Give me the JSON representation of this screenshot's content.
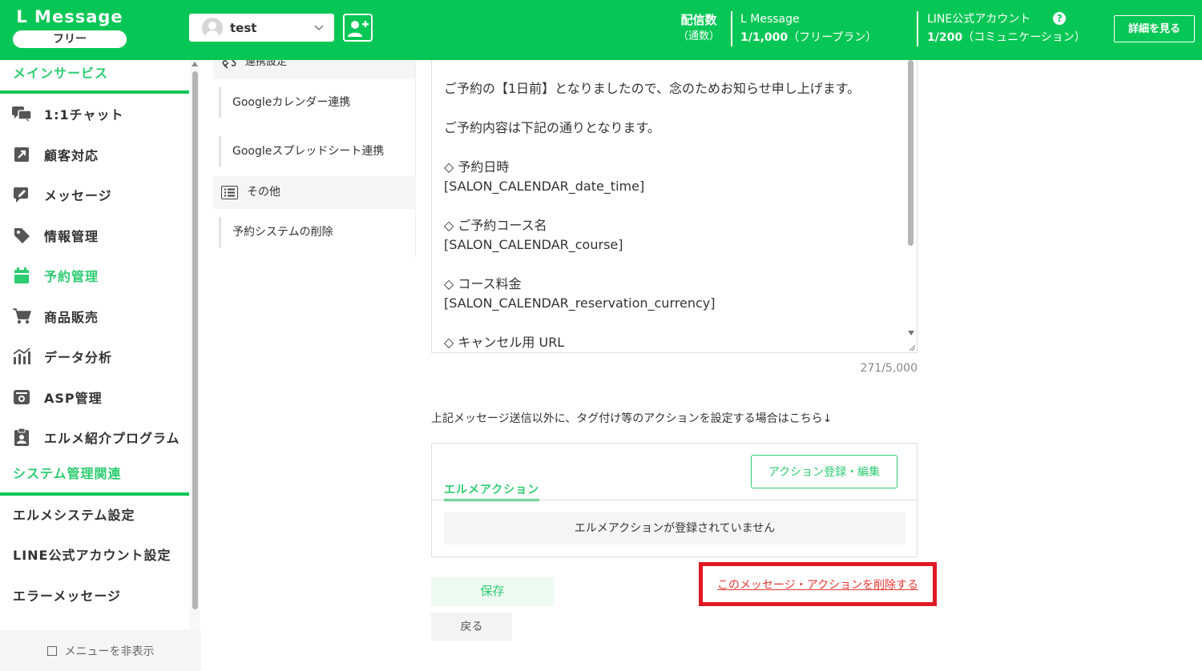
{
  "header": {
    "logo_title": "L Message",
    "logo_plan": "フリー",
    "account_name": "test",
    "stat_delivery_label": "配信数",
    "stat_delivery_sub": "（通数）",
    "lmessage_label": "L Message",
    "lmessage_count": "1/1,000",
    "lmessage_plan": "（フリープラン）",
    "line_label": "LINE公式アカウント",
    "line_count": "1/200",
    "line_plan": "（コミュニケーション）",
    "help_glyph": "?",
    "detail_button": "詳細を見る",
    "colors": {
      "brand": "#06c755",
      "accent": "#2ecc71",
      "alert": "#e01a22"
    },
    "icons": {
      "avatar": "user-avatar-icon",
      "dropdown": "chevron-down-icon",
      "add_user": "add-user-icon"
    }
  },
  "sidebar": {
    "section_main": "メインサービス",
    "items": [
      {
        "label": "1:1チャット",
        "icon": "chat-icon"
      },
      {
        "label": "顧客対応",
        "icon": "external-link-icon"
      },
      {
        "label": "メッセージ",
        "icon": "message-edit-icon"
      },
      {
        "label": "情報管理",
        "icon": "tag-icon"
      },
      {
        "label": "予約管理",
        "icon": "calendar-icon",
        "active": true
      },
      {
        "label": "商品販売",
        "icon": "cart-icon"
      },
      {
        "label": "データ分析",
        "icon": "chart-icon"
      },
      {
        "label": "ASP管理",
        "icon": "asp-icon"
      },
      {
        "label": "エルメ紹介プログラム",
        "icon": "clipboard-user-icon"
      }
    ],
    "section_system": "システム管理関連",
    "system_items": [
      "エルメシステム設定",
      "LINE公式アカウント設定",
      "エラーメッセージ"
    ],
    "footer": "メニューを非表示"
  },
  "submenu": {
    "header_partial": "連携設定",
    "items": [
      "Googleカレンダー連携",
      "Googleスプレッドシート連携"
    ],
    "other": "その他",
    "delete_system": "予約システムの削除"
  },
  "message": {
    "lines": "ご予約の【1日前】となりましたので、念のためお知らせ申し上げます。\n\nご予約内容は下記の通りとなります。\n\n◇ 予約日時\n[SALON_CALENDAR_date_time]\n\n◇ ご予約コース名\n[SALON_CALENDAR_course]\n\n◇ コース料金\n[SALON_CALENDAR_reservation_currency]\n\n◇ キャンセル用 URL",
    "counter": "271/5,000",
    "note": "上記メッセージ送信以外に、タグ付け等のアクションを設定する場合はこちら↓"
  },
  "action": {
    "tab": "エルメアクション",
    "register_button": "アクション登録・編集",
    "empty": "エルメアクションが登録されていません"
  },
  "buttons": {
    "save": "保存",
    "back": "戻る",
    "delete": "このメッセージ・アクションを削除する"
  }
}
